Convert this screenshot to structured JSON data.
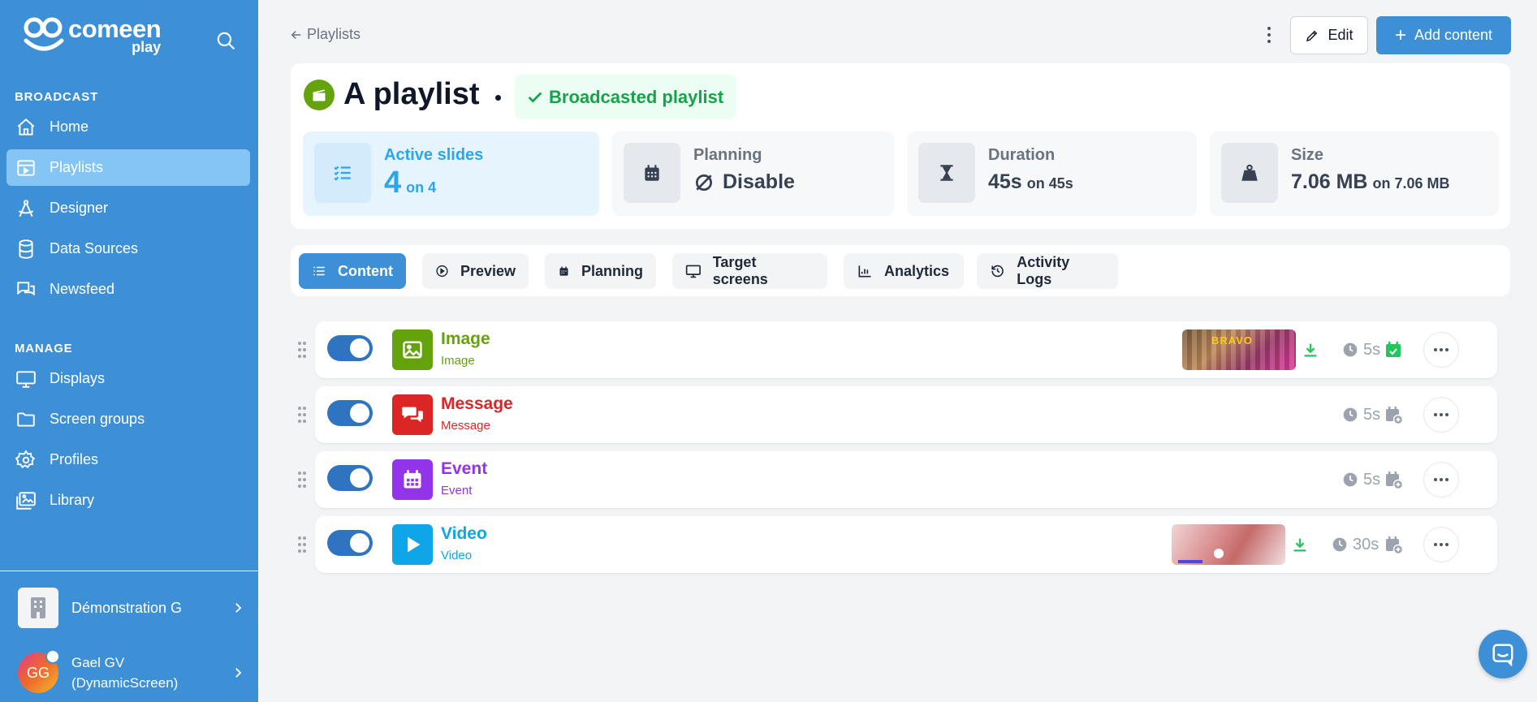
{
  "brand": {
    "name": "comeen",
    "product": "play"
  },
  "sidebar": {
    "sections": {
      "broadcast": "BROADCAST",
      "manage": "MANAGE"
    },
    "broadcast_items": [
      {
        "label": "Home",
        "icon": "home-icon"
      },
      {
        "label": "Playlists",
        "icon": "playlist-icon",
        "active": true
      },
      {
        "label": "Designer",
        "icon": "designer-icon"
      },
      {
        "label": "Data Sources",
        "icon": "database-icon"
      },
      {
        "label": "Newsfeed",
        "icon": "newsfeed-icon"
      }
    ],
    "manage_items": [
      {
        "label": "Displays",
        "icon": "monitor-icon"
      },
      {
        "label": "Screen groups",
        "icon": "folder-icon"
      },
      {
        "label": "Profiles",
        "icon": "gear-icon"
      },
      {
        "label": "Library",
        "icon": "images-icon"
      }
    ],
    "organization": "Démonstration G",
    "user": {
      "initials": "GG",
      "name_line1": "Gael GV",
      "name_line2": "(DynamicScreen)"
    }
  },
  "header": {
    "back_label": "Playlists",
    "edit_label": "Edit",
    "add_label": "Add content"
  },
  "playlist": {
    "title": "A playlist",
    "status": "Broadcasted playlist",
    "status_color": "#16a34a"
  },
  "stats": {
    "active": {
      "label": "Active slides",
      "value": "4",
      "sub": "on 4"
    },
    "planning": {
      "label": "Planning",
      "value": "Disable"
    },
    "duration": {
      "label": "Duration",
      "value": "45s",
      "sub": "on 45s"
    },
    "size": {
      "label": "Size",
      "value": "7.06 MB",
      "sub": "on 7.06 MB"
    }
  },
  "tabs": [
    {
      "label": "Content",
      "icon": "list-icon",
      "active": true
    },
    {
      "label": "Preview",
      "icon": "play-circle-icon"
    },
    {
      "label": "Planning",
      "icon": "calendar-icon"
    },
    {
      "label": "Target screens",
      "icon": "monitor-icon"
    },
    {
      "label": "Analytics",
      "icon": "chart-icon"
    },
    {
      "label": "Activity Logs",
      "icon": "history-icon"
    }
  ],
  "slides": [
    {
      "title": "Image",
      "subtitle": "Image",
      "color": "#65a30d",
      "duration": "5s",
      "enabled": true
    },
    {
      "title": "Message",
      "subtitle": "Message",
      "color": "#dc2626",
      "duration": "5s",
      "enabled": true
    },
    {
      "title": "Event",
      "subtitle": "Event",
      "color": "#9333ea",
      "duration": "5s",
      "enabled": true
    },
    {
      "title": "Video",
      "subtitle": "Video",
      "color": "#0ea5e9",
      "duration": "30s",
      "enabled": true
    }
  ],
  "thumbnails": {
    "image_banner": "BRAVO"
  },
  "colors": {
    "accent": "#3d8fd6",
    "active_stat": "#2ba6e8",
    "success": "#22c55e"
  }
}
